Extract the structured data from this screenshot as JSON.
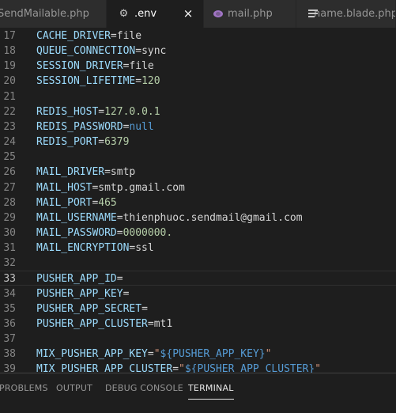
{
  "tabs": [
    {
      "label": "SendMailable.php",
      "icon": "php-icon",
      "active": false
    },
    {
      "label": ".env",
      "icon": "gear-icon",
      "active": true,
      "close": "×"
    },
    {
      "label": "mail.php",
      "icon": "php-icon",
      "active": false
    },
    {
      "label": "name.blade.php",
      "icon": "lines-icon",
      "active": false
    }
  ],
  "editor": {
    "current_line": "33",
    "lines": [
      {
        "n": "17",
        "key": "CACHE_DRIVER",
        "eq": "=",
        "val": "file",
        "kind": "plain"
      },
      {
        "n": "18",
        "key": "QUEUE_CONNECTION",
        "eq": "=",
        "val": "sync",
        "kind": "plain"
      },
      {
        "n": "19",
        "key": "SESSION_DRIVER",
        "eq": "=",
        "val": "file",
        "kind": "plain"
      },
      {
        "n": "20",
        "key": "SESSION_LIFETIME",
        "eq": "=",
        "val": "120",
        "kind": "num"
      },
      {
        "n": "21",
        "key": "",
        "eq": "",
        "val": "",
        "kind": "plain"
      },
      {
        "n": "22",
        "key": "REDIS_HOST",
        "eq": "=",
        "val": "127.0.0.1",
        "kind": "num"
      },
      {
        "n": "23",
        "key": "REDIS_PASSWORD",
        "eq": "=",
        "val": "null",
        "kind": "kw"
      },
      {
        "n": "24",
        "key": "REDIS_PORT",
        "eq": "=",
        "val": "6379",
        "kind": "num"
      },
      {
        "n": "25",
        "key": "",
        "eq": "",
        "val": "",
        "kind": "plain"
      },
      {
        "n": "26",
        "key": "MAIL_DRIVER",
        "eq": "=",
        "val": "smtp",
        "kind": "plain"
      },
      {
        "n": "27",
        "key": "MAIL_HOST",
        "eq": "=",
        "val": "smtp.gmail.com",
        "kind": "plain"
      },
      {
        "n": "28",
        "key": "MAIL_PORT",
        "eq": "=",
        "val": "465",
        "kind": "num"
      },
      {
        "n": "29",
        "key": "MAIL_USERNAME",
        "eq": "=",
        "val": "thienphuoc.sendmail@gmail.com",
        "kind": "plain"
      },
      {
        "n": "30",
        "key": "MAIL_PASSWORD",
        "eq": "=",
        "val": "0000000.",
        "kind": "num"
      },
      {
        "n": "31",
        "key": "MAIL_ENCRYPTION",
        "eq": "=",
        "val": "ssl",
        "kind": "plain"
      },
      {
        "n": "32",
        "key": "",
        "eq": "",
        "val": "",
        "kind": "plain"
      },
      {
        "n": "33",
        "key": "PUSHER_APP_ID",
        "eq": "=",
        "val": "",
        "kind": "plain"
      },
      {
        "n": "34",
        "key": "PUSHER_APP_KEY",
        "eq": "=",
        "val": "",
        "kind": "plain"
      },
      {
        "n": "35",
        "key": "PUSHER_APP_SECRET",
        "eq": "=",
        "val": "",
        "kind": "plain"
      },
      {
        "n": "36",
        "key": "PUSHER_APP_CLUSTER",
        "eq": "=",
        "val": "mt1",
        "kind": "plain"
      },
      {
        "n": "37",
        "key": "",
        "eq": "",
        "val": "",
        "kind": "plain"
      },
      {
        "n": "38",
        "key": "MIX_PUSHER_APP_KEY",
        "eq": "=",
        "q1": "\"",
        "tpl": "${PUSHER_APP_KEY}",
        "q2": "\"",
        "kind": "str"
      },
      {
        "n": "39",
        "key": "MIX_PUSHER_APP_CLUSTER",
        "eq": "=",
        "q1": "\"",
        "tpl": "${PUSHER_APP_CLUSTER}",
        "q2": "\"",
        "kind": "str"
      }
    ]
  },
  "panel": {
    "tabs": [
      "PROBLEMS",
      "OUTPUT",
      "DEBUG CONSOLE",
      "TERMINAL"
    ],
    "active": "TERMINAL"
  },
  "colors": {
    "editor_bg": "#1e1e1e",
    "key": "#9cdcfe",
    "string": "#ce9178",
    "number": "#b5cea8",
    "keyword": "#569cd6",
    "line_number": "#858585"
  }
}
